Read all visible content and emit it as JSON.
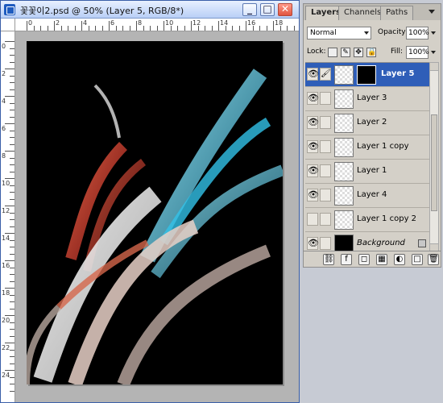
{
  "document": {
    "title": "꽃꽃이2.psd @ 50% (Layer 5, RGB/8*)",
    "ruler_labels_top": [
      "0",
      "2",
      "4",
      "6",
      "8",
      "10",
      "12",
      "14",
      "16",
      "18"
    ],
    "ruler_labels_left": [
      "0",
      "2",
      "4",
      "6",
      "8",
      "10",
      "12",
      "14",
      "16",
      "18",
      "20",
      "22",
      "24"
    ]
  },
  "layers_panel": {
    "tabs": [
      "Layers",
      "Channels",
      "Paths"
    ],
    "blend_mode": "Normal",
    "opacity_label": "Opacity:",
    "opacity_value": "100%",
    "lock_label": "Lock:",
    "fill_label": "Fill:",
    "fill_value": "100%",
    "layers": [
      {
        "name": "Layer 5",
        "selected": true,
        "visible": true
      },
      {
        "name": "Layer 3",
        "visible": true
      },
      {
        "name": "Layer 2",
        "visible": true
      },
      {
        "name": "Layer 1 copy",
        "visible": true
      },
      {
        "name": "Layer 1",
        "visible": true
      },
      {
        "name": "Layer 4",
        "visible": true
      },
      {
        "name": "Layer 1 copy 2",
        "visible": false
      },
      {
        "name": "Background",
        "visible": true,
        "locked": true
      }
    ]
  },
  "colors": {
    "canvas_bg": "#000000",
    "titlebar": "#b9cff6",
    "selected_layer": "#2f5eb8"
  }
}
